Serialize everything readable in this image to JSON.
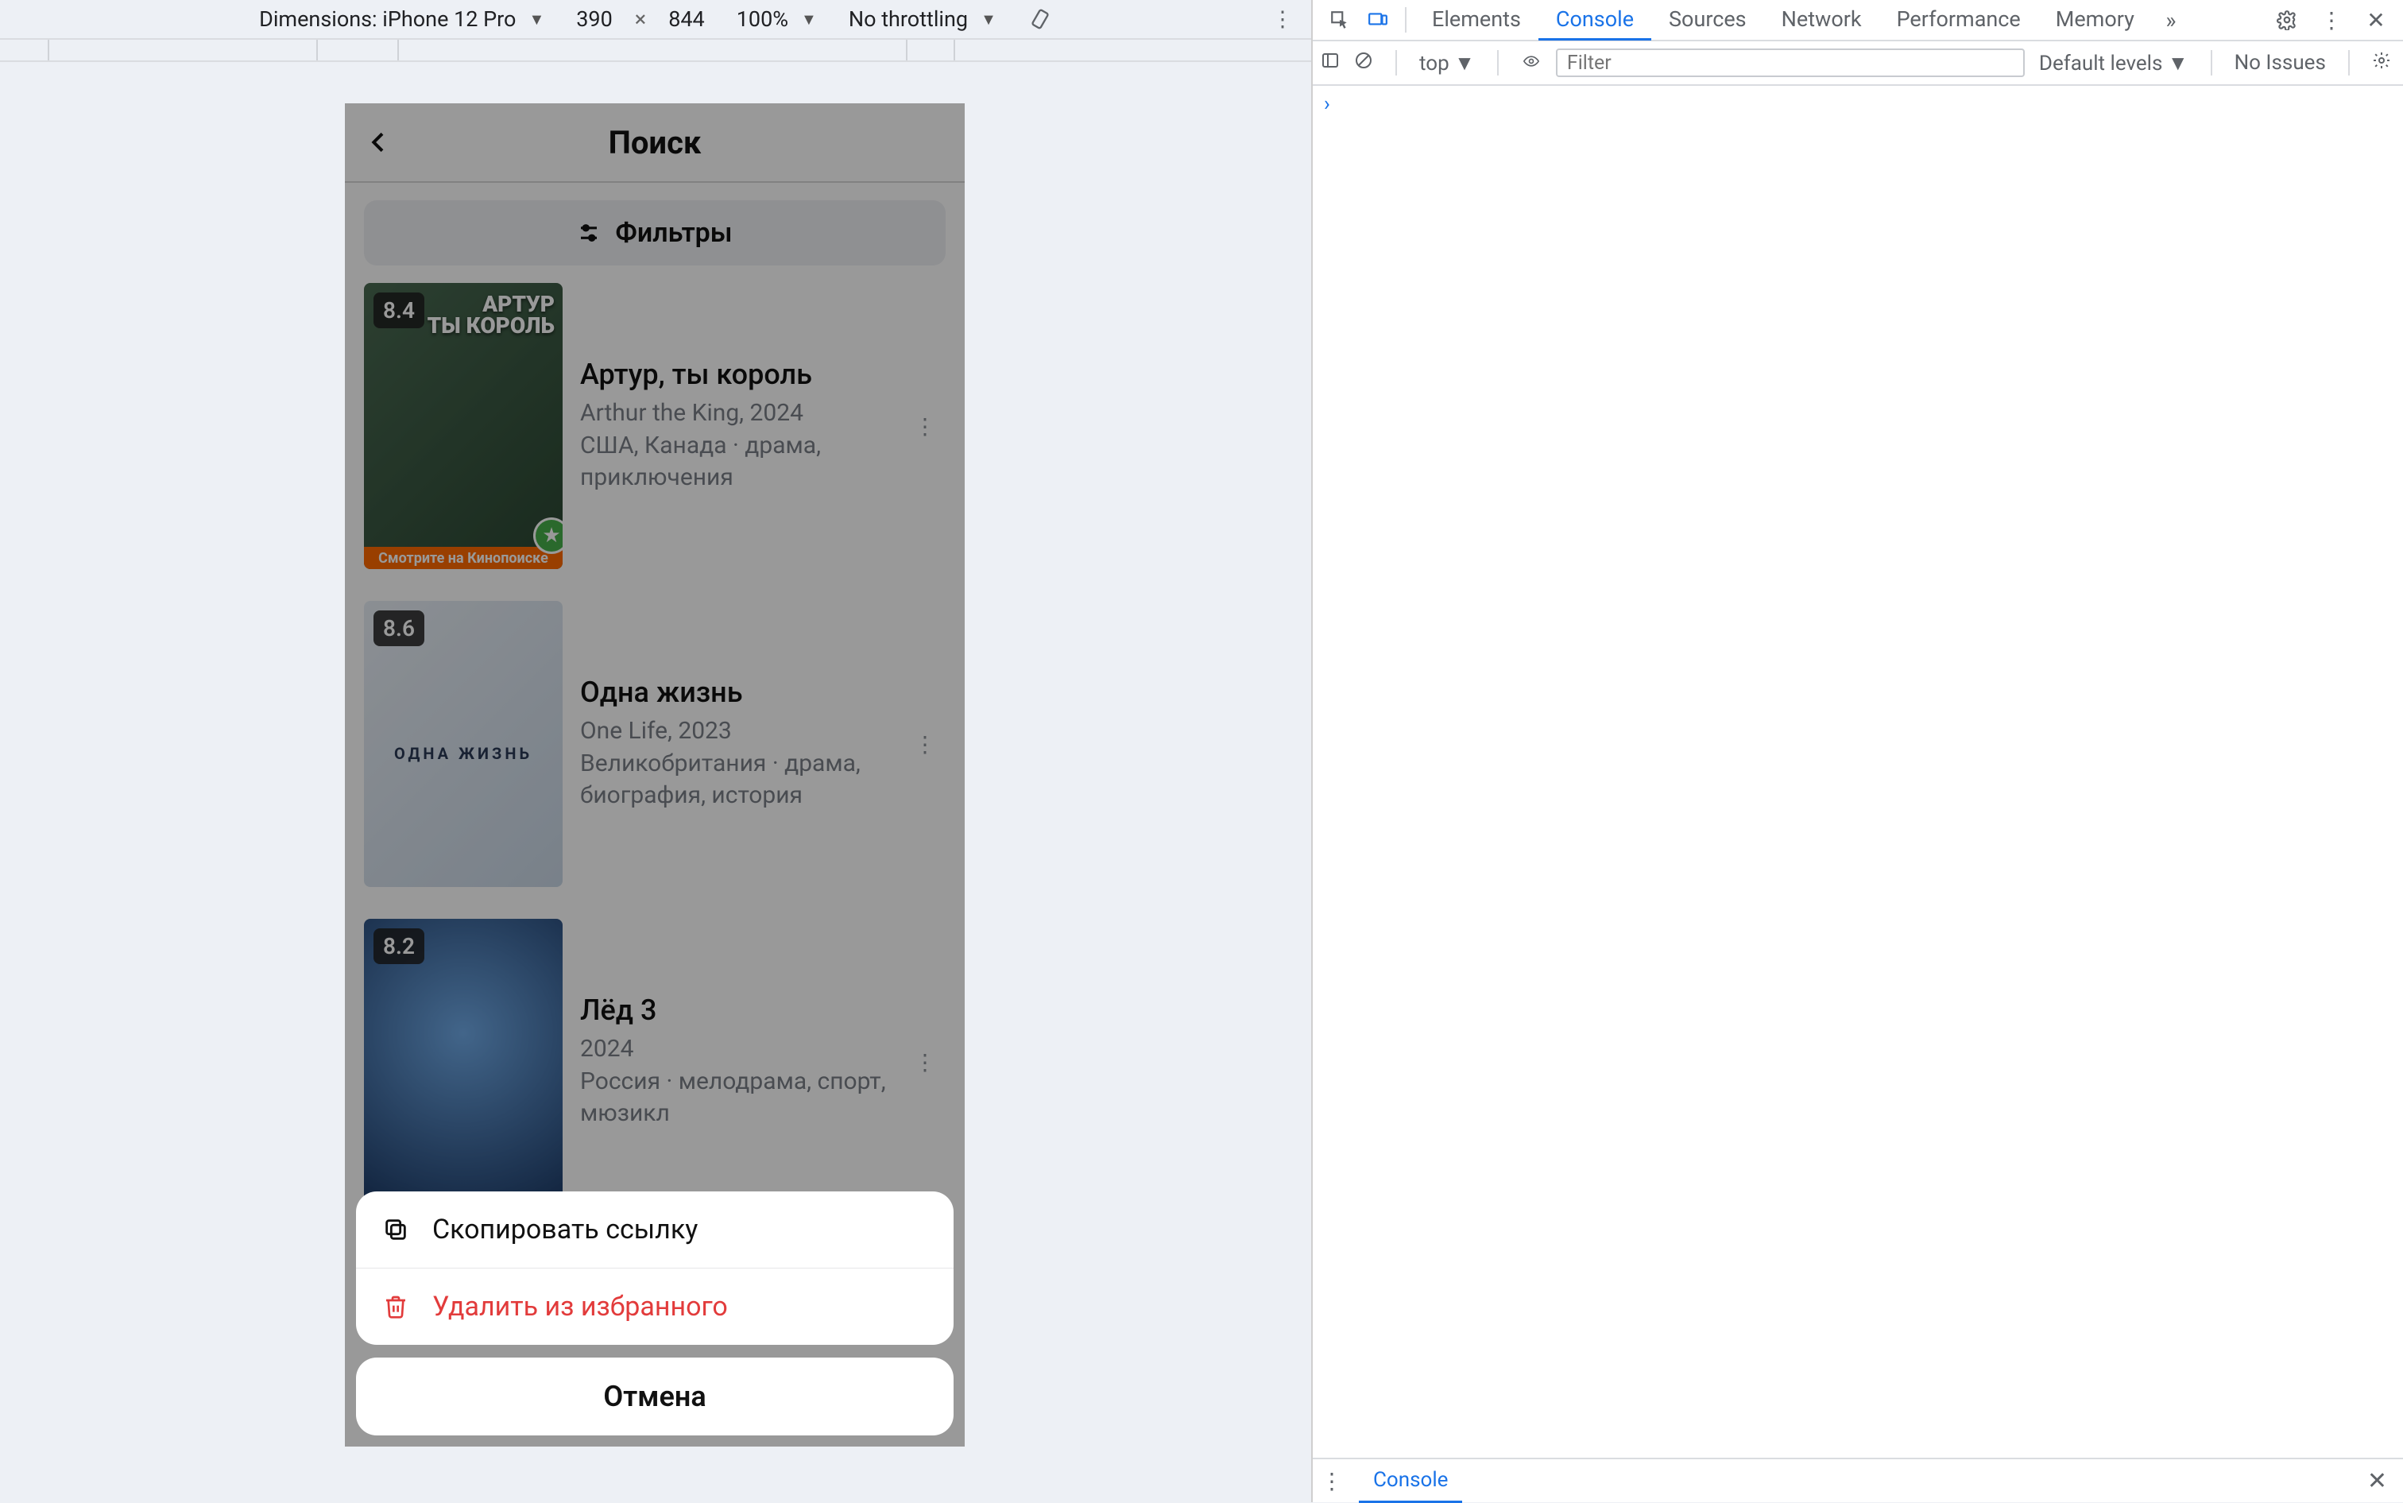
{
  "device_toolbar": {
    "dimensions_label": "Dimensions: iPhone 12 Pro",
    "width": "390",
    "height": "844",
    "zoom": "100%",
    "throttling": "No throttling"
  },
  "devtools": {
    "tabs": {
      "elements": "Elements",
      "console": "Console",
      "sources": "Sources",
      "network": "Network",
      "performance": "Performance",
      "memory": "Memory"
    },
    "console": {
      "context": "top",
      "filter_placeholder": "Filter",
      "levels": "Default levels",
      "issues": "No Issues",
      "prompt": "›"
    },
    "drawer_tab": "Console"
  },
  "app": {
    "header_title": "Поиск",
    "filters_label": "Фильтры",
    "movies": [
      {
        "rating": "8.4",
        "title": "Артур, ты король",
        "original": "Arthur the King, 2024",
        "meta": "США, Канада · драма, приключения",
        "watch_stripe": "Смотрите на Кинопоиске",
        "poster_title": "АРТУР\nТЫ КОРОЛЬ"
      },
      {
        "rating": "8.6",
        "title": "Одна жизнь",
        "original": "One Life, 2023",
        "meta": "Великобритания · драма, биография, история",
        "poster_caption": "ОДНА ЖИЗНЬ"
      },
      {
        "rating": "8.2",
        "title": "Лёд 3",
        "original": "2024",
        "meta": "Россия · мелодрама, спорт, мюзикл"
      }
    ],
    "action_sheet": {
      "copy": "Скопировать ссылку",
      "remove": "Удалить из избранного",
      "cancel": "Отмена"
    }
  }
}
